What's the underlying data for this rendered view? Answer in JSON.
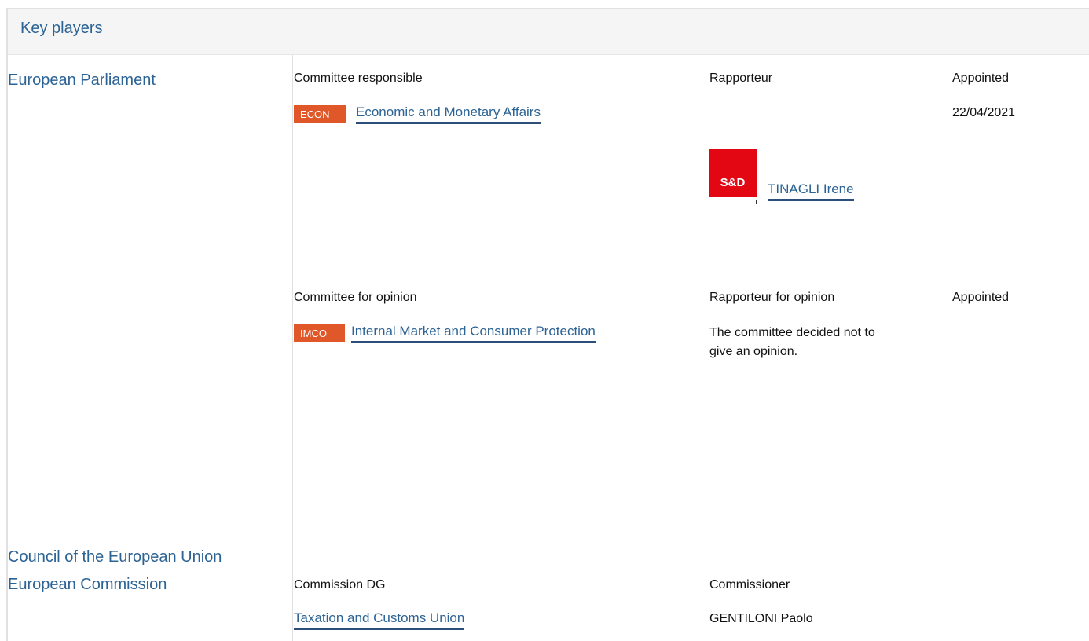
{
  "header": {
    "title": "Key players"
  },
  "institutions": {
    "parliament": "European Parliament",
    "council": "Council of the European Union",
    "commission": "European Commission"
  },
  "responsible": {
    "col_committee": "Committee responsible",
    "col_rapporteur": "Rapporteur",
    "col_appointed": "Appointed",
    "badge": "ECON",
    "committee": "Economic and Monetary Affairs",
    "appointed_date": "22/04/2021",
    "group_logo_text": "S&D",
    "rapporteur_name": "TINAGLI Irene"
  },
  "opinion": {
    "col_committee": "Committee for opinion",
    "col_rapporteur": "Rapporteur for opinion",
    "col_appointed": "Appointed",
    "badge": "IMCO",
    "committee": "Internal Market and Consumer Protection",
    "note_line1": "The committee decided not to",
    "note_line2": "give an opinion."
  },
  "commission": {
    "col_dg": "Commission DG",
    "col_commissioner": "Commissioner",
    "dg": "Taxation and Customs Union",
    "commissioner": "GENTILONI Paolo"
  },
  "colors": {
    "link": "#2c6395",
    "badge": "#e0582a",
    "sd_red": "#e30613"
  }
}
